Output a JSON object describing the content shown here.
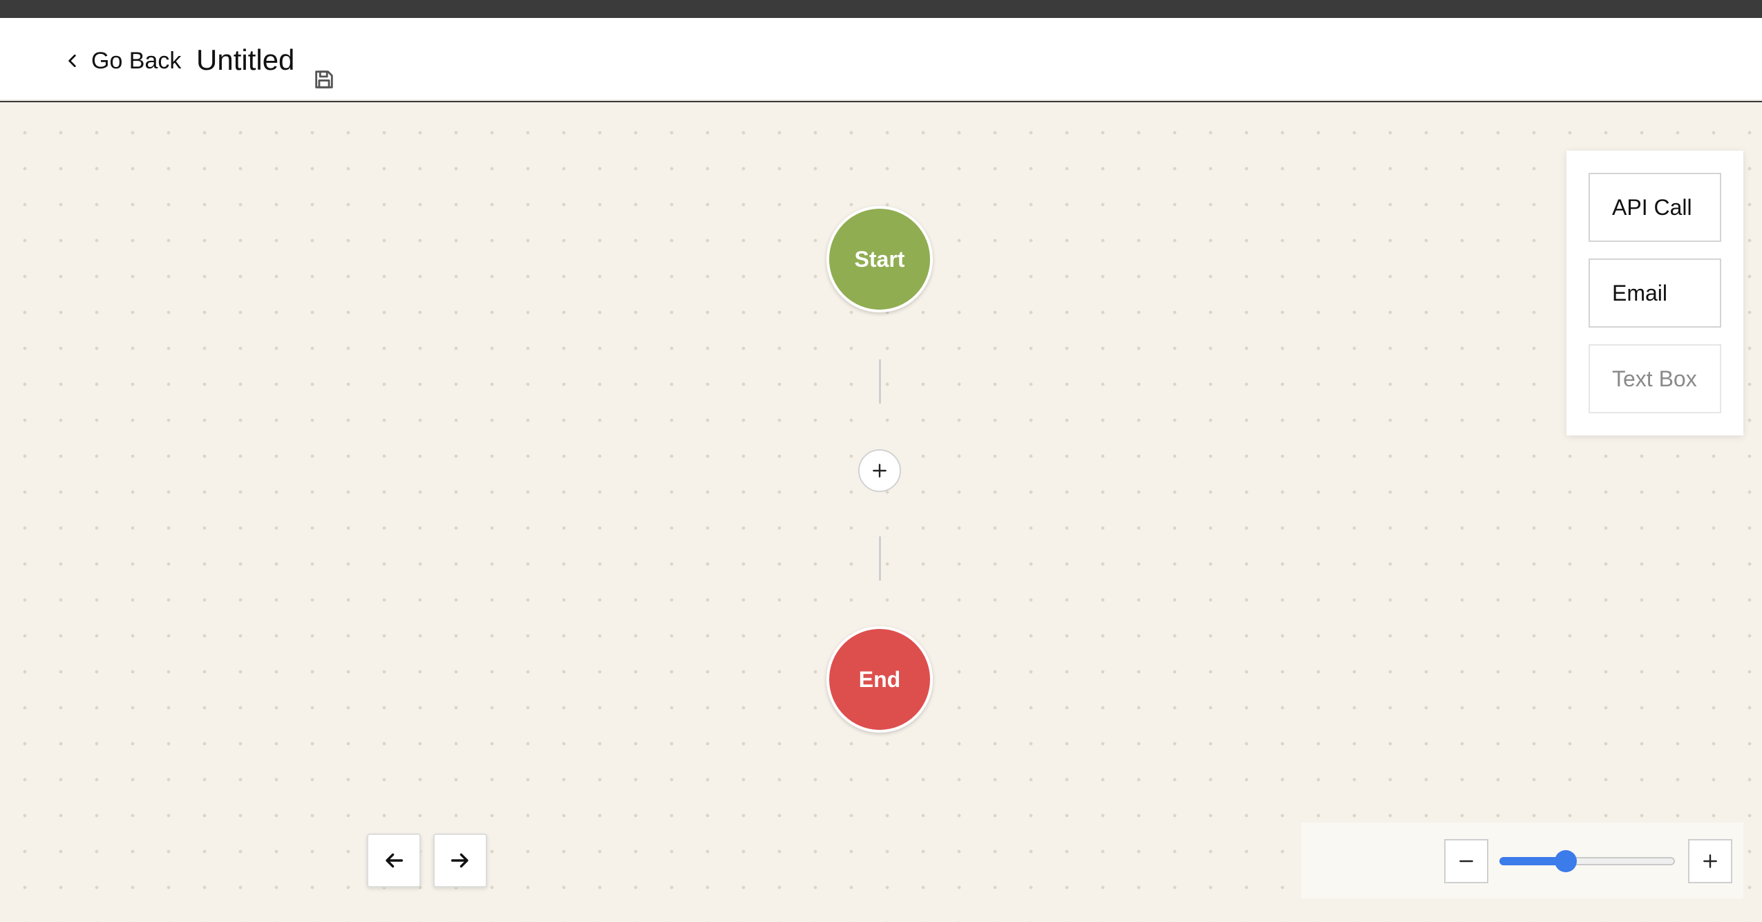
{
  "header": {
    "back_label": "Go Back",
    "title": "Untitled"
  },
  "flow": {
    "start": {
      "label": "Start",
      "color": "#90ad51"
    },
    "end": {
      "label": "End",
      "color": "#dd4f4d"
    }
  },
  "palette": {
    "items": [
      {
        "label": "API Call"
      },
      {
        "label": "Email"
      },
      {
        "label": "Text Box"
      }
    ]
  },
  "zoom": {
    "level": 0.37,
    "accent": "#3b7bea"
  },
  "icons": {
    "back": "chevron-left-icon",
    "save": "floppy-disk-icon",
    "add": "plus-icon",
    "undo": "arrow-left-icon",
    "redo": "arrow-right-icon",
    "zoom_out": "minus-icon",
    "zoom_in": "plus-icon"
  }
}
